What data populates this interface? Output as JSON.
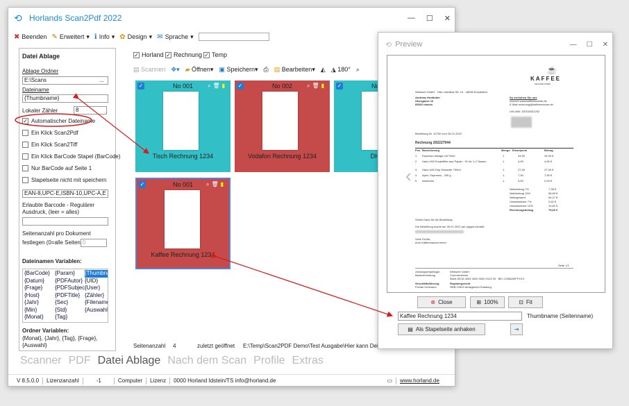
{
  "main": {
    "title": "Horlands Scan2Pdf 2022",
    "menu": [
      "Beenden",
      "Erweitert",
      "Info",
      "Design",
      "Sprache"
    ],
    "left_panel": {
      "title": "Datei Ablage",
      "folder_label": "Ablage Ordner",
      "folder_value": "E:\\Scans",
      "folder_btn": "...",
      "filename_label": "Dateiname",
      "filename_value": "{Thumbname}",
      "counter_label": "Lokaler Zähler",
      "counter_value": "8",
      "checkboxes": [
        {
          "label": "Automatischer Dateiname",
          "checked": true
        },
        {
          "label": "Ein Klick Scan2Pdf",
          "checked": false
        },
        {
          "label": "Ein Klick Scan2Tiff",
          "checked": false
        },
        {
          "label": "Ein Klick BarCode Stapel (BarCode)",
          "checked": false
        },
        {
          "label": "Nur BarCode auf Seite 1",
          "checked": false
        },
        {
          "label": "Stapelseite nicht mit speichern",
          "checked": false
        }
      ],
      "barcode_select": "EAN-8,UPC-E,ISBN-10,UPC-A,E",
      "barcode_note": "Erlaubte Barcode - Regulärer Ausdruck, (leer = alles)",
      "pages_label": "Seitenanzahl pro Dokument festlegen (0=alle Seiten)",
      "pages_value": "0",
      "vars_title": "Dateinamen Variablen:",
      "vars": [
        "{BarCode}",
        "{Param}",
        "{Thumbnai",
        "{Datum}",
        "{PDFAutor}",
        "{UID}",
        "{Frage}",
        "{PDFSubject}",
        "{User}",
        "{Host}",
        "{PDFTitle}",
        "{Zähler}",
        "{Jahr}",
        "{Sec}",
        "{Filename",
        "{Min}",
        "{Std}",
        "{Auswahl}",
        "{Monat}",
        "{Tag}",
        ""
      ],
      "folder_vars_title": "Ordner Variablen:",
      "folder_vars": "{Monat}, {Jahr}, {Tag}, {Frage}, {Auswahl}"
    },
    "filters": [
      "Horland",
      "Rechnung",
      "Temp"
    ],
    "toolbar": [
      "Scannen",
      "Öffnen",
      "Speichern",
      "Bearbeiten",
      "180°"
    ],
    "tiles": [
      {
        "no": "No 001",
        "name": "Tisch Rechnung 1234",
        "color": "#33bfc6"
      },
      {
        "no": "No 002",
        "name": "Vodafon Rechnung 1234",
        "color": "#c54a4a"
      },
      {
        "no": "No 003",
        "name": "DHL Re",
        "color": "#33bfc6"
      },
      {
        "no": "No 001",
        "name": "Kaffee Rechnung 1234",
        "color": "#c54a4a"
      }
    ],
    "info_bar": {
      "pages_label": "Seitenanzahl",
      "pages_value": "4",
      "last_opened": "zuletzt geöffnet",
      "path": "E:\\Temp\\Scan2PDF Demo\\Test Ausgabe\\Hier kann Deine Ausg"
    },
    "tabs": [
      "Scanner",
      "PDF",
      "Datei Ablage",
      "Nach dem Scan",
      "Profile",
      "Extras"
    ],
    "status": {
      "version": "V 8.5.0.0",
      "license_count_label": "Lizenzanzahl",
      "license_count": "-1",
      "computer": "Computer",
      "license": "Lizenz",
      "owner": "0000 Horland Idstein/TS info@horland.de",
      "site": "www.horland.de"
    }
  },
  "preview": {
    "title": "Preview",
    "invoice": {
      "brand": "KAFFEE",
      "brand_sub": "MACHER INNEN",
      "sender_line": "Webseel GmbH · Otto-Lilienthal Str. 10 · 48336 Emsdetten",
      "recipient": [
        "Andreas Horländer",
        "Obergasse 10",
        "65510 Idstein"
      ],
      "contact_title": "So erreichen Sie uns",
      "contact": [
        "Internet   www.kaffeemacher.de",
        "E-Mail   rechnung@kaffeemacher.de"
      ],
      "ust": "USt-IdNr.   DE334331202",
      "order": "Bestellung Nr. 10762 vom 26.01.2022",
      "heading": "Rechnung 202227044",
      "cols": [
        "Pos",
        "Bezeichnung",
        "Menge",
        "Einzelpreis",
        "Betrag"
      ],
      "rows": [
        [
          "1",
          "Espresso Waage mit Timer",
          "1",
          "34,90",
          "34,90 €"
        ],
        [
          "2",
          "Hario V60 Ersatzfilter aus Papier - 01 für 1-2 Tassen",
          "1",
          "4,90",
          "4,90 €"
        ],
        [
          "3",
          "Hario V60 Drip Dekanter 700ml",
          "1",
          "27,90",
          "27,90 €"
        ],
        [
          "4",
          "Apex, Espresso - 250 g",
          "1",
          "7,90",
          "7,90 €"
        ],
        [
          "5",
          "kostenlos",
          "1",
          "0,00",
          "0,00 €"
        ]
      ],
      "totals": [
        [
          "Nettobetrag 7%",
          "7,38 €"
        ],
        [
          "Nettobetrag 19%",
          "56,89 €"
        ],
        [
          "Nettogesamt",
          "64,27 €"
        ],
        [
          "Umsatzsteuer 7%",
          "0,52 €"
        ],
        [
          "Umsatzsteuer 19%",
          "10,81 €"
        ],
        [
          "Rechnungsbetrag",
          "75,60 €"
        ]
      ],
      "thanks": "Vielen Dank für die Bestellung.",
      "paid": "Die Bestellung wurde am 26.01.2022 per paypal bezahlt.",
      "greeting": [
        "Viele Grüße,",
        "eure Kaffeemacher:innen"
      ],
      "page": "Seite 1/1",
      "footer_labels": [
        "Zahlungsempfänger",
        "Bankverbindung",
        "Geschäftsführung",
        "Registergericht"
      ],
      "footer_values": [
        "Webseel GmbH",
        "Commerzbank",
        "Florian Hohmann",
        "HRB 19302 Amtsgericht Duisburg"
      ],
      "iban": "IBAN DE16 4004 0000 0000 0123 00 · BIC COBADEFFXXX"
    },
    "buttons": {
      "close": "Close",
      "zoom": "100%",
      "fit": "Fit",
      "attach": "Als Stapelseite anhaken"
    },
    "thumbname_value": "Kaffee Rechnung 1234",
    "thumbname_label": "Thumbname (Seitenname)"
  },
  "colors": {
    "accent": "#1e8ad2",
    "tile_teal": "#33bfc6",
    "tile_red": "#c54a4a",
    "annotation": "#d61c1c"
  }
}
